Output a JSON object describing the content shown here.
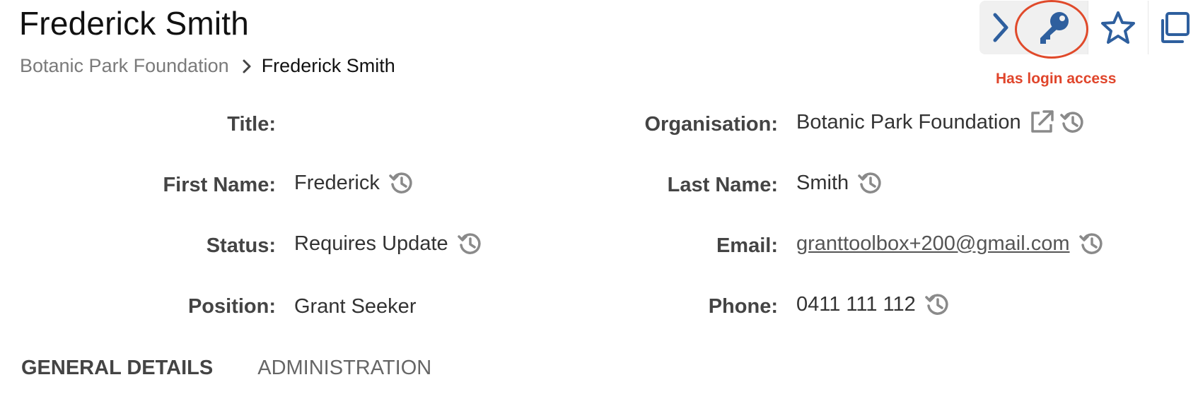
{
  "header": {
    "title": "Frederick Smith",
    "breadcrumb": {
      "parent": "Botanic Park Foundation",
      "current": "Frederick Smith"
    }
  },
  "toolbar": {
    "icons": [
      "chevron-right-icon",
      "key-icon",
      "star-icon",
      "copy-icon"
    ],
    "annotation": "Has login access",
    "accent_color": "#2e5f9e",
    "annotation_color": "#e04a2b"
  },
  "fields": {
    "title": {
      "label": "Title:",
      "value": ""
    },
    "first_name": {
      "label": "First Name:",
      "value": "Frederick"
    },
    "status": {
      "label": "Status:",
      "value": "Requires Update"
    },
    "position": {
      "label": "Position:",
      "value": "Grant Seeker"
    },
    "organisation": {
      "label": "Organisation:",
      "value": "Botanic Park Foundation"
    },
    "last_name": {
      "label": "Last Name:",
      "value": "Smith"
    },
    "email": {
      "label": "Email:",
      "value": "granttoolbox+200@gmail.com"
    },
    "phone": {
      "label": "Phone:",
      "value": "0411 111 112"
    }
  },
  "tabs": [
    {
      "label": "GENERAL DETAILS",
      "active": true
    },
    {
      "label": "ADMINISTRATION",
      "active": false
    }
  ]
}
